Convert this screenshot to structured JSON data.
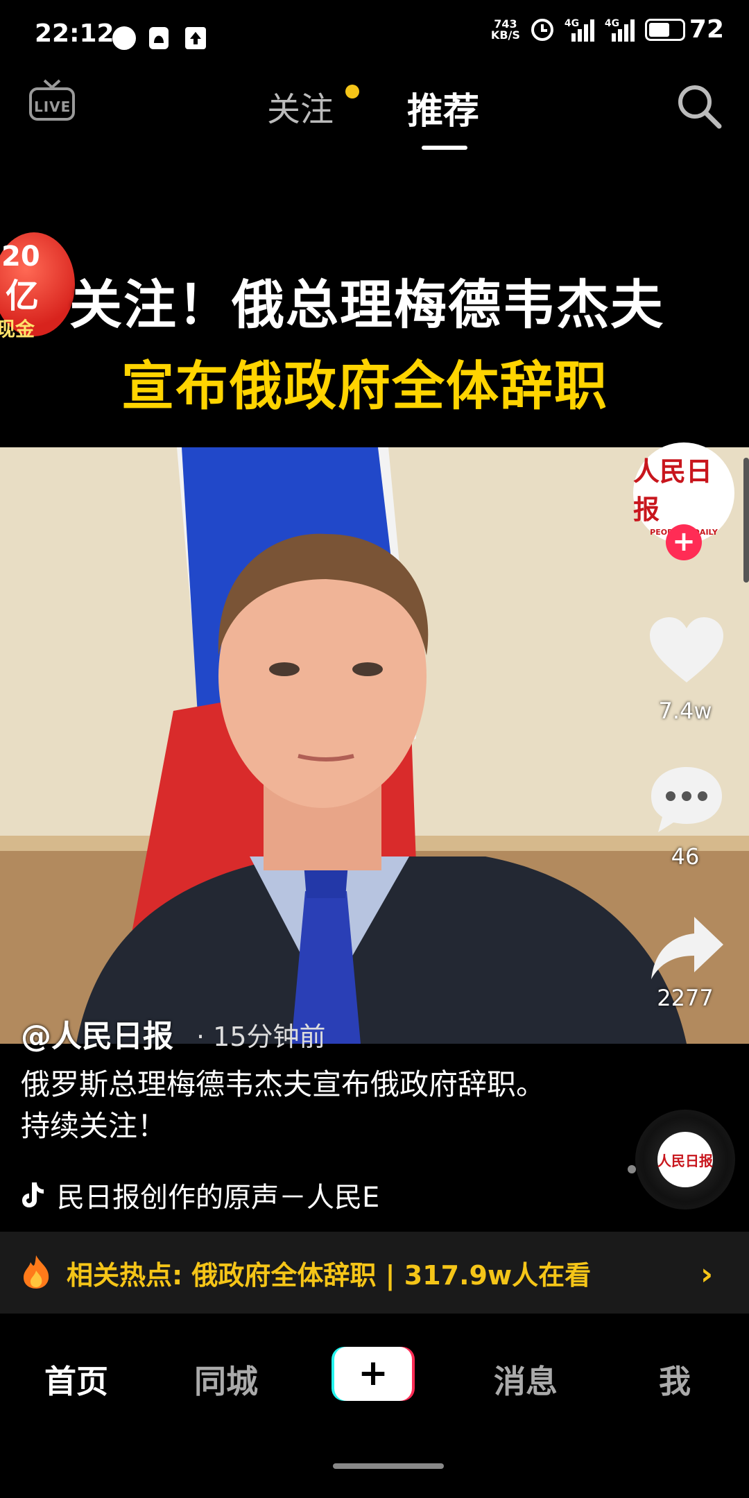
{
  "status_bar": {
    "time": "22:12",
    "network_speed_value": "743",
    "network_speed_unit": "KB/S",
    "signal1_label": "4G",
    "signal2_label": "4G",
    "battery": "72",
    "battery_level": 0.72
  },
  "top_nav": {
    "live_label": "LIVE",
    "tab_follow": "关注",
    "tab_recommend": "推荐"
  },
  "video": {
    "headline_line1": "关注！俄总理梅德韦杰夫",
    "headline_line2": "宣布俄政府全体辞职",
    "promo_badge_line1": "20",
    "promo_badge_line2": "亿",
    "promo_badge_line3": "现金"
  },
  "actions": {
    "avatar_text": "人民日报",
    "avatar_subtext": "PEOPLE'S DAILY",
    "likes": "7.4w",
    "comments": "46",
    "shares": "2277"
  },
  "post": {
    "author": "@人民日报",
    "time_ago": "· 15分钟前",
    "caption": "俄罗斯总理梅德韦杰夫宣布俄政府辞职。持续关注！",
    "music": "民日报创作的原声－人民E",
    "disc_text": "人民日报"
  },
  "hot_topic": {
    "text": "相关热点: 俄政府全体辞职 | 317.9w人在看",
    "arrow": "›"
  },
  "bottom_nav": {
    "home": "首页",
    "city": "同城",
    "create": "+",
    "messages": "消息",
    "me": "我"
  },
  "colors": {
    "accent_yellow": "#f5c518",
    "like_red": "#ff2c55",
    "brand_red": "#c8161d"
  }
}
